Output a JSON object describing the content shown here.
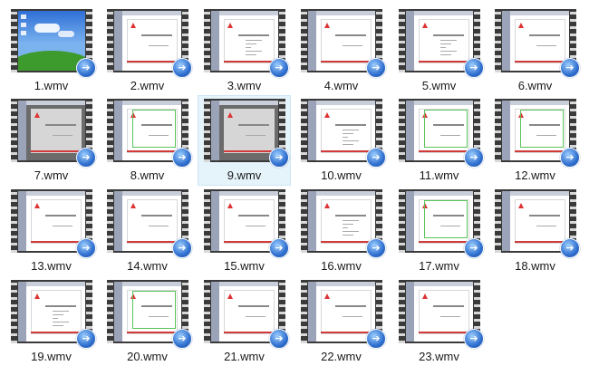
{
  "files": [
    {
      "name": "1.wmv",
      "kind": "desktop"
    },
    {
      "name": "2.wmv",
      "kind": "slide-title"
    },
    {
      "name": "3.wmv",
      "kind": "slide-toc"
    },
    {
      "name": "4.wmv",
      "kind": "slide-title"
    },
    {
      "name": "5.wmv",
      "kind": "slide-list"
    },
    {
      "name": "6.wmv",
      "kind": "slide-title"
    },
    {
      "name": "7.wmv",
      "kind": "slide-dark"
    },
    {
      "name": "8.wmv",
      "kind": "slide-green"
    },
    {
      "name": "9.wmv",
      "kind": "slide-dark"
    },
    {
      "name": "10.wmv",
      "kind": "slide-list"
    },
    {
      "name": "11.wmv",
      "kind": "slide-green"
    },
    {
      "name": "12.wmv",
      "kind": "slide-green"
    },
    {
      "name": "13.wmv",
      "kind": "slide-title"
    },
    {
      "name": "14.wmv",
      "kind": "slide-title"
    },
    {
      "name": "15.wmv",
      "kind": "slide-title"
    },
    {
      "name": "16.wmv",
      "kind": "slide-list"
    },
    {
      "name": "17.wmv",
      "kind": "slide-green"
    },
    {
      "name": "18.wmv",
      "kind": "slide-title"
    },
    {
      "name": "19.wmv",
      "kind": "slide-list"
    },
    {
      "name": "20.wmv",
      "kind": "slide-green"
    },
    {
      "name": "21.wmv",
      "kind": "slide-title"
    },
    {
      "name": "22.wmv",
      "kind": "slide-title"
    },
    {
      "name": "23.wmv",
      "kind": "slide-title"
    }
  ],
  "selected_index": 8,
  "icons": {
    "play_overlay": "play-arrow-icon",
    "play_glyph": "➔"
  },
  "colors": {
    "selection_bg": "#e5f3fb",
    "selection_border": "#cfe6f5",
    "play_blue": "#2f6fcf",
    "slide_accent_red": "#d23a3a",
    "slide_outline_green": "#5ac35a"
  }
}
